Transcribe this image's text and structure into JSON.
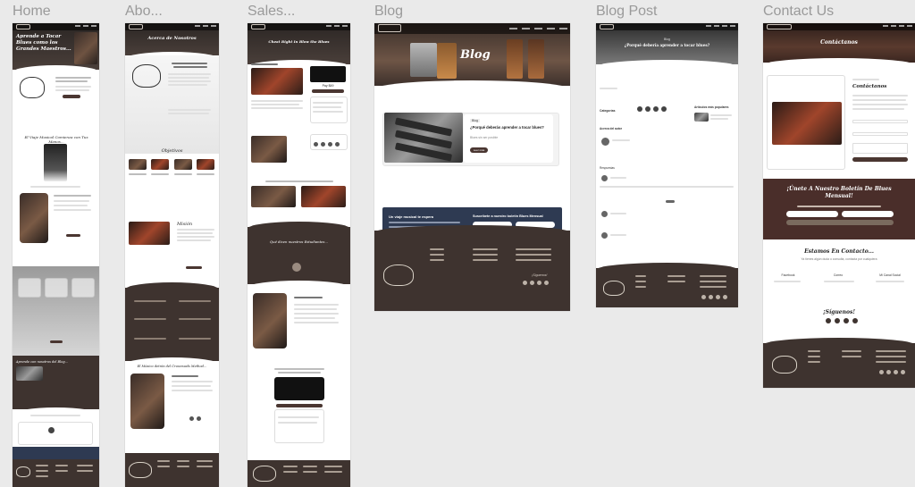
{
  "frames": [
    {
      "id": "home",
      "label": "Home"
    },
    {
      "id": "about",
      "label": "Abo..."
    },
    {
      "id": "sales",
      "label": "Sales..."
    },
    {
      "id": "blog",
      "label": "Blog"
    },
    {
      "id": "blog_post",
      "label": "Blog Post"
    },
    {
      "id": "contact",
      "label": "Contact Us"
    }
  ],
  "home": {
    "hero_title": "Aprende a Tocar Blues como los Grandes Maestros...",
    "section_title": "El Viaje Musical Comienza con Tus Manos...",
    "blog_heading": "Aprende con nosotros del Blog..."
  },
  "about": {
    "hero_title": "Acerca de Nosotros",
    "objectives_title": "Objetivos",
    "mission_title": "Misión",
    "founder_title": "El Músico detrás del Crossroads Method..."
  },
  "sales": {
    "hero_title": "Cheat Right In Blow the Blues",
    "price": "Pay $49",
    "review_title": "Qué dicen nuestros Estudiantes..."
  },
  "blog": {
    "hero_title": "Blog",
    "card_tag": "Blog",
    "card_title": "¿Porqué deberás aprender a tocar blues?",
    "card_meta": "Blues sin ser posible",
    "card_button": "Leer más",
    "newsletter_title": "Un viaje musical te espera",
    "newsletter_right_title": "Suscríbete a nuestro boletín Blues Mensual",
    "footer_follow": "¡Síguenos!"
  },
  "blog_post": {
    "hero_title": "¿Porqué debería aprender a tocar blues?",
    "hero_tag": "Blog",
    "categories_label": "Categorías",
    "popular_label": "Artículos más populares",
    "author_label": "Acerca del autor",
    "replies_label": "Respuestas"
  },
  "contact": {
    "hero_title": "Contáctanos",
    "form_title": "Contáctanos",
    "newsletter_title": "¡Únete A Nuestro Boletín De Blues Mensual!",
    "connect_title": "Estamos En Contacto...",
    "connect_subtitle": "Ya tienes algún duda o consulta, contacta por cualquiera",
    "follow_title": "¡Síguenos!",
    "channels": [
      "Facebook",
      "Correo",
      "Mi Canal Social"
    ]
  },
  "colors": {
    "dark_brown": "#3e332f",
    "button_brown": "#4a3631",
    "newsletter_navy": "#2e3a52",
    "canvas": "#eaeaea"
  }
}
